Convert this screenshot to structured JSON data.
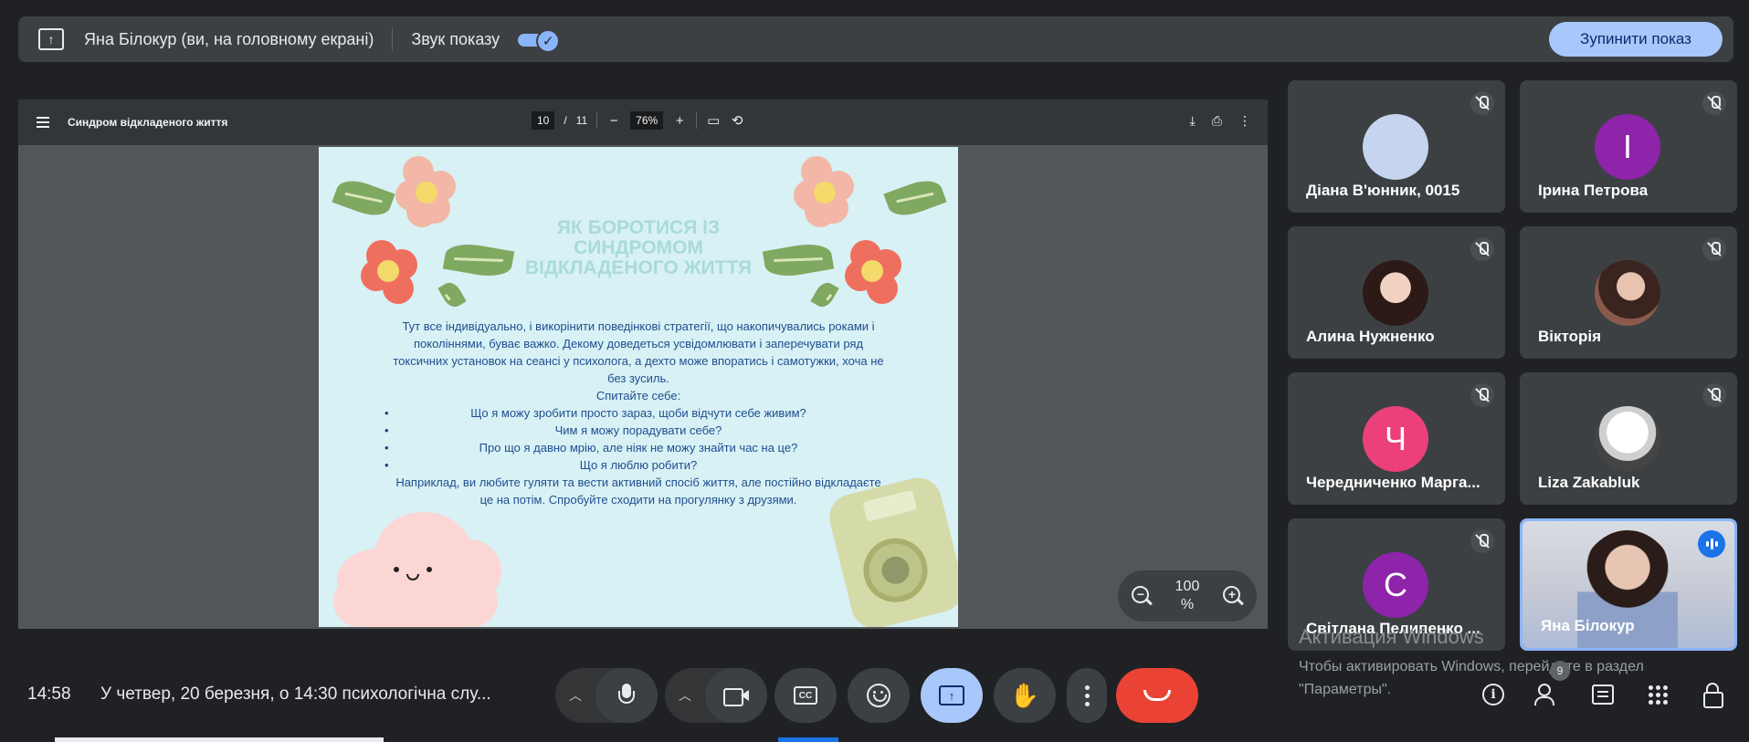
{
  "topbar": {
    "presenter_label": "Яна Білокур (ви, на головному екрані)",
    "sound_label": "Звук показу",
    "sound_enabled": true,
    "stop_button": "Зупинити показ"
  },
  "pdf": {
    "title": "Синдром відкладеного життя",
    "page_current": "10",
    "page_sep": "/",
    "page_total": "11",
    "zoom": "76%",
    "heading": "ЯК БОРОТИСЯ ІЗ СИНДРОМОМ ВІДКЛАДЕНОГО ЖИТТЯ",
    "paragraph": "Тут все індивідуально, і викорінити поведінкові стратегії, що накопичувались роками і поколіннями, буває важко. Декому доведеться усвідомлювати і заперечувати ряд токсичних установок на сеансі у психолога, а дехто може впоратись і самотужки, хоча не без зусиль.",
    "ask_label": "Спитайте себе:",
    "questions": [
      "Що я можу зробити просто зараз, щоби відчути себе живим?",
      "Чим я можу порадувати себе?",
      "Про що я давно мрію, але ніяк не можу знайти час на це?",
      "Що я люблю робити?"
    ],
    "closing": "Наприклад, ви любите гуляти та вести активний спосіб життя, але постійно відкладаєте це на потім. Спробуйте сходити на прогулянку з друзями."
  },
  "zoom_control": {
    "value": "100",
    "unit": "%"
  },
  "participants": [
    {
      "name": "Діана В'юнник, 0015",
      "initial": "",
      "avatar_color": "#c5d5ef",
      "muted": true
    },
    {
      "name": "Ірина Петрова",
      "initial": "І",
      "avatar_color": "#8e24aa",
      "muted": true
    },
    {
      "name": "Алина Нужненко",
      "initial": "",
      "avatar_color": "",
      "muted": true
    },
    {
      "name": "Вікторія",
      "initial": "",
      "avatar_color": "",
      "muted": true
    },
    {
      "name": "Чередниченко Марга...",
      "initial": "Ч",
      "avatar_color": "#ec407a",
      "muted": true
    },
    {
      "name": "Liza Zakabluk",
      "initial": "",
      "avatar_color": "",
      "muted": true
    },
    {
      "name": "Світлана Пелипенко ...",
      "initial": "С",
      "avatar_color": "#8e24aa",
      "muted": true
    },
    {
      "name": "Яна Білокур",
      "initial": "",
      "avatar_color": "",
      "muted": false,
      "speaking": true
    }
  ],
  "watermark": {
    "title": "Активация Windows",
    "subtitle": "Чтобы активировать Windows, перейдите в раздел \"Параметры\"."
  },
  "bottombar": {
    "time": "14:58",
    "meeting_title": "У четвер, 20 березня, о 14:30 психологічна слу...",
    "people_count": "9",
    "colors": {
      "hangup": "#ea4335",
      "present_active": "#a8c7fa",
      "accent": "#8ab4f8"
    }
  }
}
